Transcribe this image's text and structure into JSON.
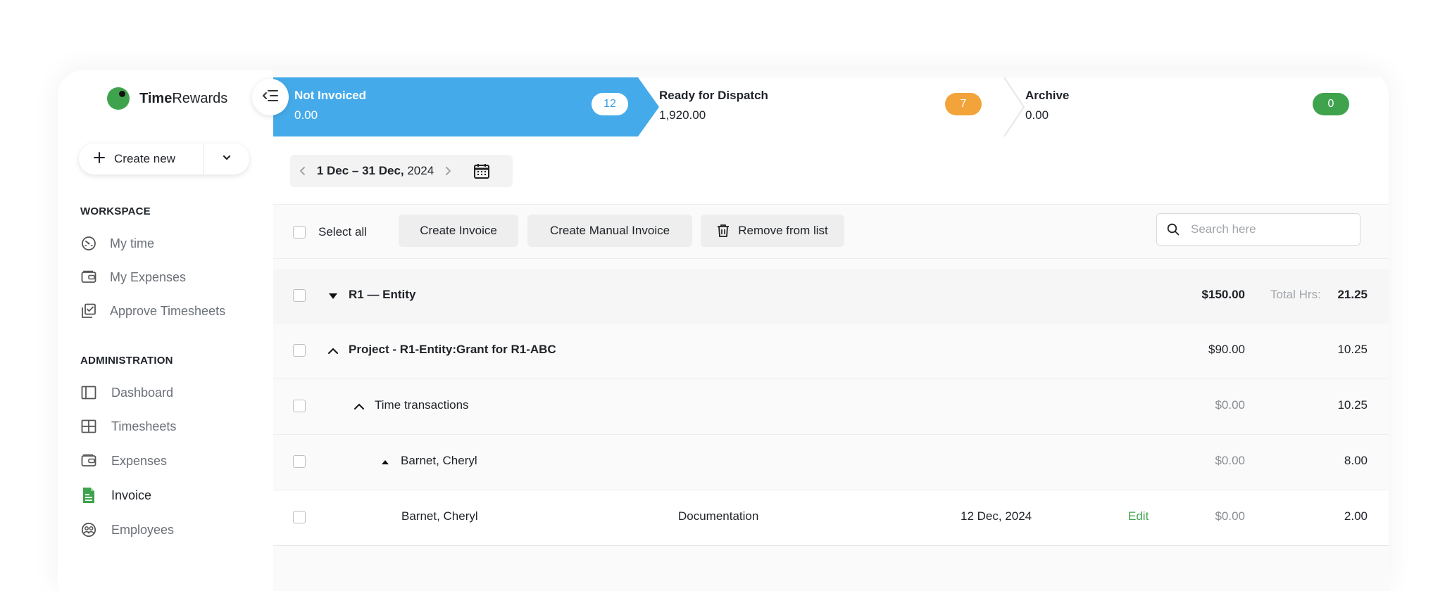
{
  "app": {
    "brand_bold": "Time",
    "brand_rest": "Rewards"
  },
  "sidebar": {
    "create_new": "Create new",
    "workspace_label": "WORKSPACE",
    "workspace_items": [
      {
        "label": "My time",
        "icon": "stopwatch-icon"
      },
      {
        "label": "My Expenses",
        "icon": "wallet-icon"
      },
      {
        "label": "Approve Timesheets",
        "icon": "approve-icon"
      }
    ],
    "admin_label": "ADMINISTRATION",
    "admin_items": [
      {
        "label": "Dashboard",
        "icon": "dashboard-icon"
      },
      {
        "label": "Timesheets",
        "icon": "grid-icon"
      },
      {
        "label": "Expenses",
        "icon": "wallet-icon"
      },
      {
        "label": "Invoice",
        "icon": "document-icon",
        "active": true
      },
      {
        "label": "Employees",
        "icon": "employees-icon"
      }
    ]
  },
  "stepper": [
    {
      "title": "Not Invoiced",
      "value": "0.00",
      "count": "12",
      "active": true
    },
    {
      "title": "Ready for Dispatch",
      "value": "1,920.00",
      "count": "7"
    },
    {
      "title": "Archive",
      "value": "0.00",
      "count": "0"
    }
  ],
  "colors": {
    "active_step": "#45aaea",
    "badge_orange": "#f2a43a",
    "badge_green": "#3fa34d",
    "edit_link": "#3fa34d",
    "brand_green": "#3fa34d"
  },
  "date_range": {
    "bold": "1 Dec – 31 Dec,",
    "rest": " 2024"
  },
  "toolbar": {
    "select_all": "Select all",
    "create_invoice": "Create Invoice",
    "create_manual_invoice": "Create Manual Invoice",
    "remove_from_list": "Remove from list",
    "search_placeholder": "Search here"
  },
  "table": {
    "entity": {
      "label": "R1 — Entity",
      "amount": "$150.00",
      "total_label": "Total Hrs:",
      "hours": "21.25"
    },
    "project": {
      "label": "Project - R1-Entity:Grant for R1-ABC",
      "amount": "$90.00",
      "hours": "10.25"
    },
    "time_tx": {
      "label": "Time transactions",
      "amount": "$0.00",
      "hours": "10.25"
    },
    "person": {
      "label": "Barnet, Cheryl",
      "amount": "$0.00",
      "hours": "8.00"
    },
    "entry": {
      "name": "Barnet, Cheryl",
      "task": "Documentation",
      "date": "12 Dec, 2024",
      "action": "Edit",
      "amount": "$0.00",
      "hours": "2.00"
    }
  }
}
